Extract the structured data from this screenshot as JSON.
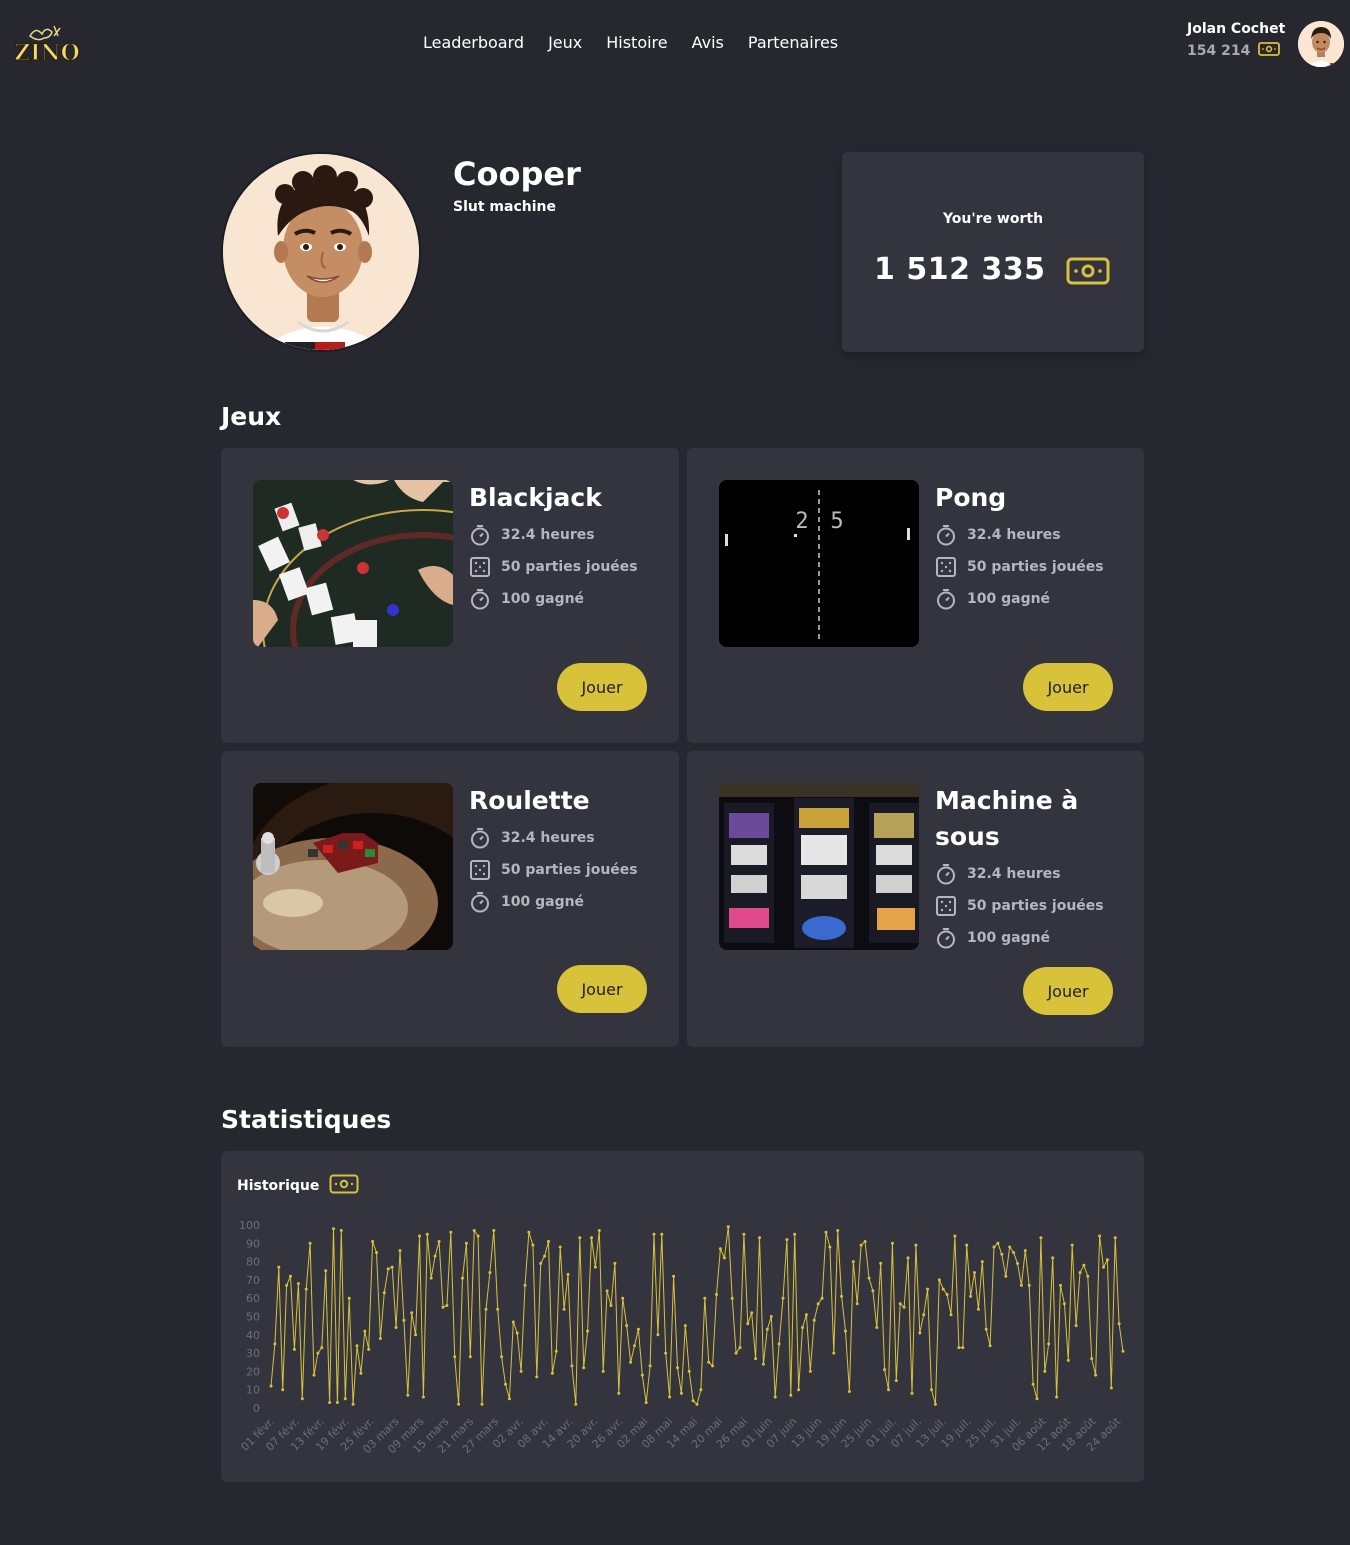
{
  "header": {
    "brand": "ZINO",
    "nav": [
      "Leaderboard",
      "Jeux",
      "Histoire",
      "Avis",
      "Partenaires"
    ],
    "user": {
      "name": "Jolan Cochet",
      "balance": "154 214"
    }
  },
  "profile": {
    "name": "Cooper",
    "subtitle": "Slut machine",
    "worth_label": "You're worth",
    "worth_value": "1 512 335"
  },
  "games_section": {
    "title": "Jeux"
  },
  "games": [
    {
      "title": "Blackjack",
      "hours": "32.4 heures",
      "played": "50 parties jouées",
      "won": "100 gagné",
      "button": "Jouer"
    },
    {
      "title": "Pong",
      "hours": "32.4 heures",
      "played": "50 parties jouées",
      "won": "100 gagné",
      "button": "Jouer",
      "score_left": "2",
      "score_right": "5"
    },
    {
      "title": "Roulette",
      "hours": "32.4 heures",
      "played": "50 parties jouées",
      "won": "100 gagné",
      "button": "Jouer"
    },
    {
      "title": "Machine à sous",
      "hours": "32.4 heures",
      "played": "50 parties jouées",
      "won": "100 gagné",
      "button": "Jouer"
    }
  ],
  "stats_section": {
    "title": "Statistiques"
  },
  "colors": {
    "accent": "#d8c23a",
    "card": "#34343f",
    "background": "#272730"
  },
  "chart_data": {
    "type": "line",
    "title": "Historique",
    "ylim": [
      0,
      100
    ],
    "yticks": [
      0,
      10,
      20,
      30,
      40,
      50,
      60,
      70,
      80,
      90,
      100
    ],
    "x_tick_labels": [
      "01 févr.",
      "07 févr.",
      "13 févr.",
      "19 févr.",
      "25 févr.",
      "03 mars",
      "09 mars",
      "15 mars",
      "21 mars",
      "27 mars",
      "02 avr.",
      "08 avr.",
      "14 avr.",
      "20 avr.",
      "26 avr.",
      "02 mai",
      "08 mai",
      "14 mai",
      "20 mai",
      "26 mai",
      "01 juin",
      "07 juin",
      "13 juin",
      "19 juin",
      "25 juin",
      "01 juil.",
      "07 juil.",
      "13 juil.",
      "19 juil.",
      "25 juil.",
      "31 juil.",
      "06 août",
      "12 août",
      "18 août",
      "24 août"
    ],
    "grid": false,
    "values": [
      12,
      35,
      77,
      10,
      67,
      72,
      32,
      68,
      5,
      65,
      90,
      18,
      30,
      33,
      75,
      3,
      98,
      3,
      97,
      5,
      60,
      2,
      34,
      19,
      42,
      32,
      91,
      85,
      38,
      63,
      76,
      77,
      44,
      86,
      48,
      7,
      52,
      40,
      94,
      6,
      95,
      71,
      83,
      91,
      55,
      56,
      96,
      28,
      2,
      71,
      90,
      28,
      97,
      94,
      2,
      54,
      74,
      97,
      54,
      28,
      13,
      5,
      47,
      41,
      20,
      67,
      96,
      89,
      17,
      79,
      83,
      91,
      19,
      31,
      88,
      54,
      73,
      23,
      2,
      93,
      22,
      42,
      93,
      77,
      97,
      20,
      64,
      56,
      79,
      8,
      60,
      45,
      25,
      34,
      43,
      18,
      3,
      23,
      95,
      40,
      95,
      30,
      6,
      72,
      22,
      8,
      45,
      20,
      4,
      2,
      10,
      60,
      25,
      23,
      62,
      87,
      82,
      99,
      60,
      30,
      33,
      95,
      46,
      52,
      27,
      93,
      24,
      43,
      50,
      6,
      35,
      60,
      92,
      7,
      95,
      10,
      44,
      51,
      20,
      48,
      57,
      60,
      96,
      88,
      30,
      97,
      61,
      42,
      9,
      80,
      57,
      89,
      91,
      71,
      64,
      44,
      79,
      21,
      10,
      90,
      15,
      57,
      55,
      82,
      8,
      89,
      41,
      51,
      65,
      10,
      2,
      70,
      65,
      62,
      51,
      94,
      33,
      33,
      89,
      61,
      74,
      54,
      80,
      43,
      34,
      88,
      90,
      84,
      72,
      88,
      85,
      79,
      67,
      86,
      67,
      13,
      5,
      93,
      20,
      35,
      82,
      6,
      67,
      57,
      26,
      89,
      45,
      74,
      78,
      72,
      27,
      18,
      94,
      77,
      81,
      11,
      93,
      46,
      31
    ]
  }
}
